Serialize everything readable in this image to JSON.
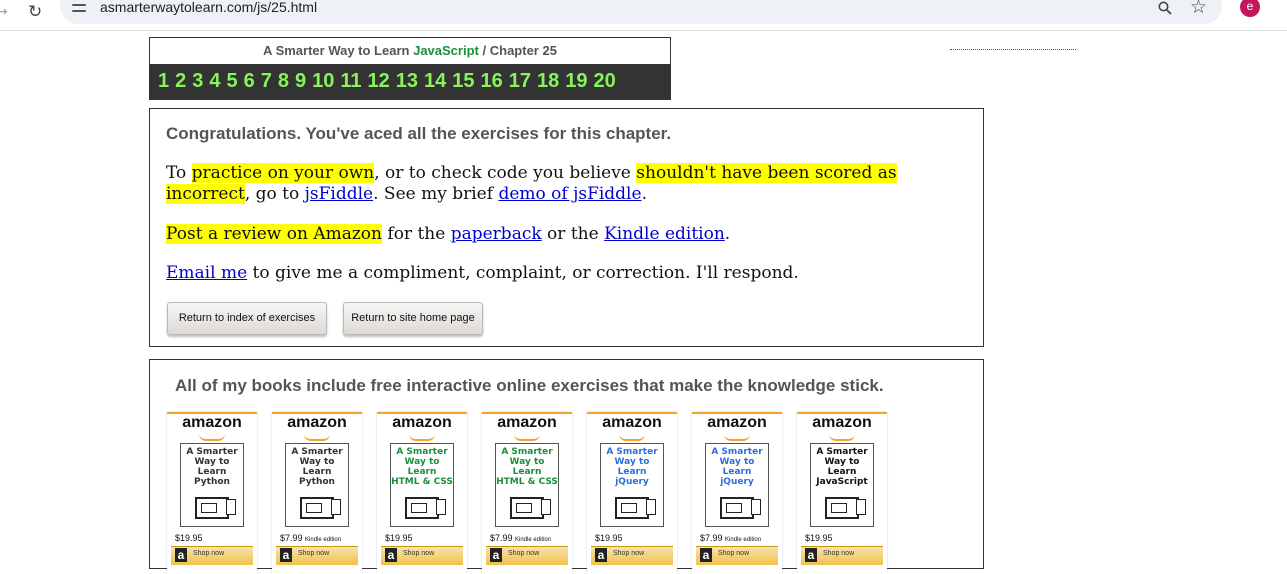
{
  "browser": {
    "url": "asmarterwaytolearn.com/js/25.html",
    "avatar_letter": "e"
  },
  "header": {
    "prefix": "A Smarter Way to Learn",
    "subject": "JavaScript",
    "separator": "/",
    "chapter": "Chapter 25",
    "chapters": [
      "1",
      "2",
      "3",
      "4",
      "5",
      "6",
      "7",
      "8",
      "9",
      "10",
      "11",
      "12",
      "13",
      "14",
      "15",
      "16",
      "17",
      "18",
      "19",
      "20"
    ]
  },
  "congrats": {
    "title": "Congratulations. You've aced all the exercises for this chapter.",
    "p1_a": "To ",
    "p1_hl1": "practice on your own",
    "p1_b": ", or to check code you believe ",
    "p1_hl2": "shouldn't have been scored as incorrect",
    "p1_c": ", go to ",
    "p1_link1": "jsFiddle",
    "p1_d": ". See my brief ",
    "p1_link2": "demo of jsFiddle",
    "p1_e": ".",
    "p2_hl": "Post a review on Amazon",
    "p2_a": " for the ",
    "p2_link1": "paperback",
    "p2_b": " or the ",
    "p2_link2": "Kindle edition",
    "p2_c": ".",
    "p3_link": "Email me",
    "p3_a": " to give me a compliment, complaint, or correction. I'll respond.",
    "btn_index": "Return to index of exercises",
    "btn_home": "Return to site home page"
  },
  "books": {
    "title": "All of my books include free interactive online exercises that make the knowledge stick.",
    "amazon_label": "amazon",
    "shop_label": "Shop now",
    "items": [
      {
        "t1": "A Smarter",
        "t2": "Way to",
        "t3": "Learn",
        "t4": "Python",
        "color": "#333333",
        "price": "$19.95",
        "edition": ""
      },
      {
        "t1": "A Smarter",
        "t2": "Way to",
        "t3": "Learn",
        "t4": "Python",
        "color": "#333333",
        "price": "$7.99",
        "edition": "Kindle edition"
      },
      {
        "t1": "A Smarter",
        "t2": "Way to",
        "t3": "Learn",
        "t4": "HTML & CSS",
        "color": "#1a8f3a",
        "price": "$19.95",
        "edition": ""
      },
      {
        "t1": "A Smarter",
        "t2": "Way to",
        "t3": "Learn",
        "t4": "HTML & CSS",
        "color": "#1a8f3a",
        "price": "$7.99",
        "edition": "Kindle edition"
      },
      {
        "t1": "A Smarter",
        "t2": "Way to",
        "t3": "Learn",
        "t4": "jQuery",
        "color": "#2a6fdb",
        "price": "$19.95",
        "edition": ""
      },
      {
        "t1": "A Smarter",
        "t2": "Way to",
        "t3": "Learn",
        "t4": "jQuery",
        "color": "#2a6fdb",
        "price": "$7.99",
        "edition": "Kindle edition"
      },
      {
        "t1": "A Smarter",
        "t2": "Way to",
        "t3": "Learn",
        "t4": "JavaScript",
        "color": "#111111",
        "price": "$19.95",
        "edition": ""
      }
    ]
  }
}
